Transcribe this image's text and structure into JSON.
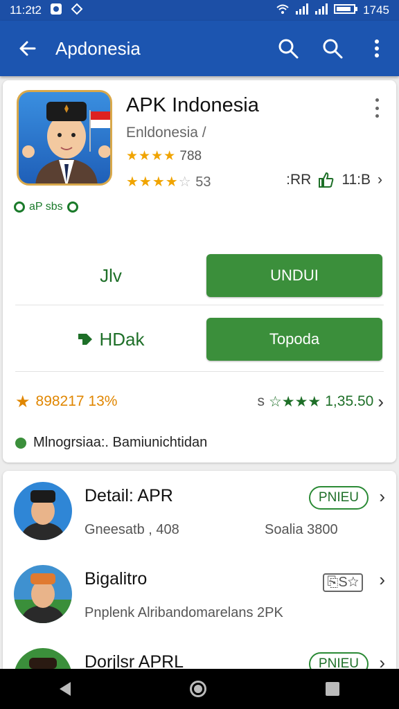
{
  "status_bar": {
    "time": "11:2t2",
    "clock_right": "1745"
  },
  "app_bar": {
    "title": "Apdonesia"
  },
  "app": {
    "name": "APK Indonesia",
    "publisher": "Enldonesia /",
    "rating_line1": "788",
    "rating_line2": "53",
    "meta_left": ":RR",
    "meta_right": "11:B",
    "badge_text": "aP sbs"
  },
  "actions": {
    "row1_label": "Jlv",
    "row1_button": "UNDUI",
    "row2_label": "HDak",
    "row2_button": "Topoda"
  },
  "stats": {
    "left_value": "898217 13%",
    "right_prefix": "s",
    "right_value": "1,35.50"
  },
  "note": "Mlnogrsiaa:. Bamiunichtidan",
  "list": [
    {
      "title": "Detail: APR",
      "sub_left": "Gneesatb , 408",
      "sub_right": "Soalia 3800",
      "pill": "PNIEU"
    },
    {
      "title": "Bigalitro",
      "sub_left": "Pnplenk Alribandomarelans 2PK",
      "badge": "S"
    },
    {
      "title": "Dorjlsr APRL",
      "pill": "PNIEU"
    }
  ],
  "colors": {
    "primary": "#1c55b0",
    "accent_green": "#3b8f3b",
    "star": "#f0a400"
  }
}
